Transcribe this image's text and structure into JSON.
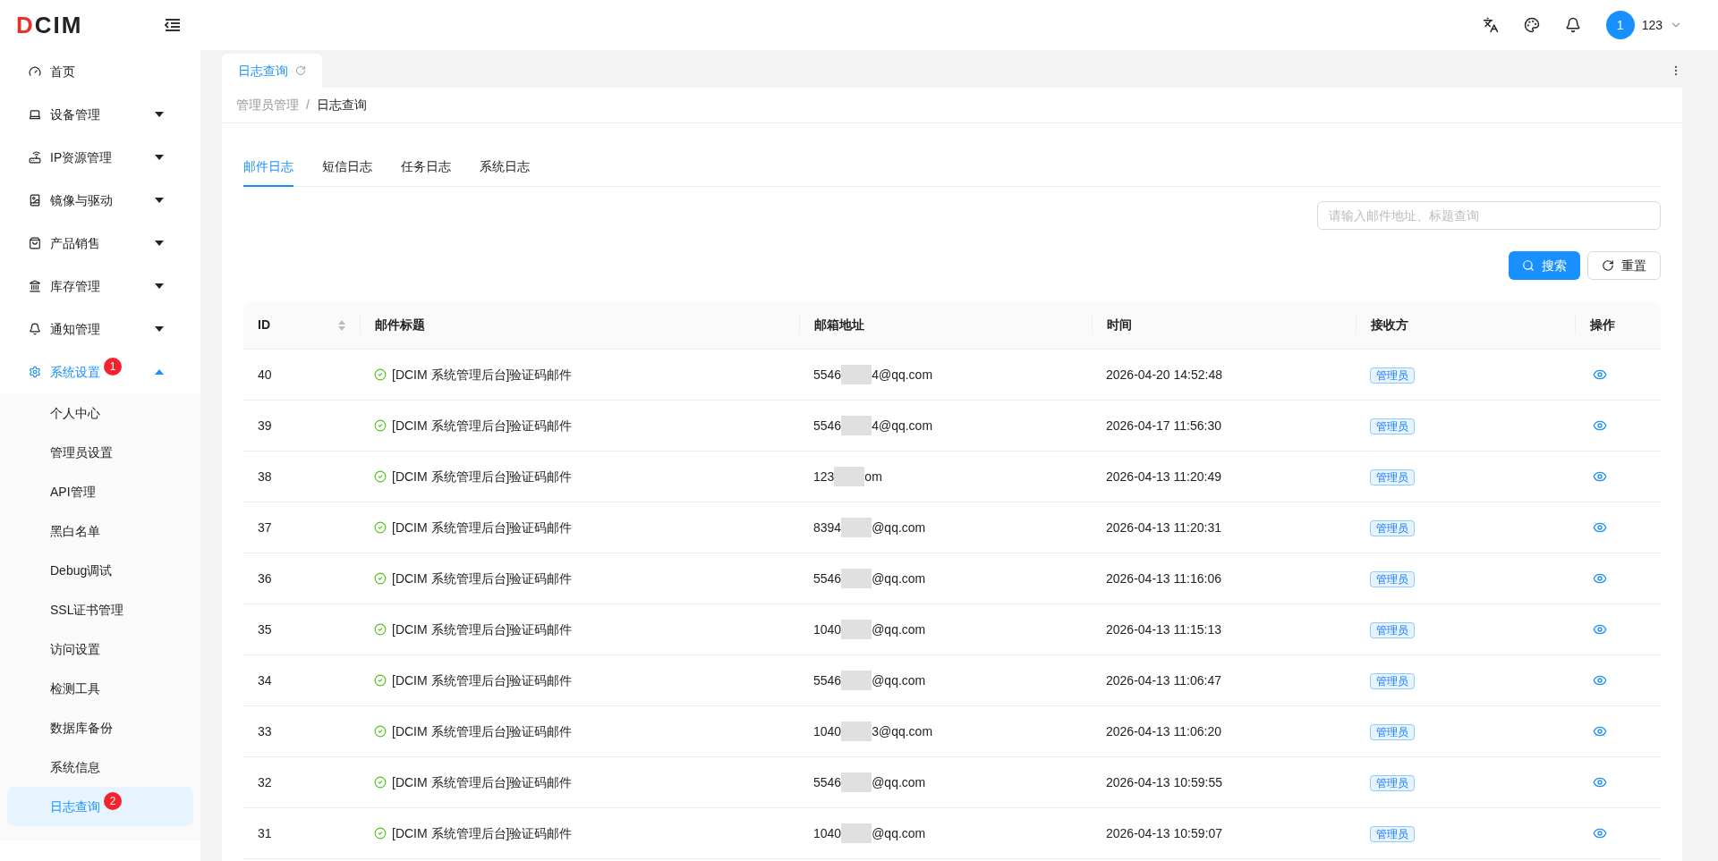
{
  "brand": {
    "text": "DCIM"
  },
  "header": {
    "avatar": "1",
    "user": "123"
  },
  "sidebar": {
    "items": [
      {
        "label": "首页",
        "expandable": false,
        "expanded": false,
        "selected": false
      },
      {
        "label": "设备管理",
        "expandable": true,
        "expanded": false,
        "selected": false
      },
      {
        "label": "IP资源管理",
        "expandable": true,
        "expanded": false,
        "selected": false
      },
      {
        "label": "镜像与驱动",
        "expandable": true,
        "expanded": false,
        "selected": false
      },
      {
        "label": "产品销售",
        "expandable": true,
        "expanded": false,
        "selected": false
      },
      {
        "label": "库存管理",
        "expandable": true,
        "expanded": false,
        "selected": false
      },
      {
        "label": "通知管理",
        "expandable": true,
        "expanded": false,
        "selected": false
      },
      {
        "label": "系统设置",
        "expandable": true,
        "expanded": true,
        "selected": true,
        "badge": "1",
        "children": [
          {
            "label": "个人中心",
            "selected": false
          },
          {
            "label": "管理员设置",
            "selected": false
          },
          {
            "label": "API管理",
            "selected": false
          },
          {
            "label": "黑白名单",
            "selected": false
          },
          {
            "label": "Debug调试",
            "selected": false
          },
          {
            "label": "SSL证书管理",
            "selected": false
          },
          {
            "label": "访问设置",
            "selected": false
          },
          {
            "label": "检测工具",
            "selected": false
          },
          {
            "label": "数据库备份",
            "selected": false
          },
          {
            "label": "系统信息",
            "selected": false
          },
          {
            "label": "日志查询",
            "selected": true,
            "badge": "2"
          }
        ]
      }
    ]
  },
  "page_tabs": [
    {
      "label": "日志查询",
      "selected": true
    }
  ],
  "breadcrumb": [
    "管理员管理",
    "/",
    "日志查询"
  ],
  "tabs": [
    {
      "label": "邮件日志",
      "selected": true
    },
    {
      "label": "短信日志",
      "selected": false
    },
    {
      "label": "任务日志",
      "selected": false
    },
    {
      "label": "系统日志",
      "selected": false
    }
  ],
  "search": {
    "placeholder": "请输入邮件地址、标题查询"
  },
  "buttons": [
    {
      "label": "搜索",
      "kind": "primary"
    },
    {
      "label": "重置",
      "kind": "default"
    }
  ],
  "table": {
    "columns": [
      "ID",
      "邮件标题",
      "邮箱地址",
      "时间",
      "接收方",
      "操作"
    ],
    "rows": [
      {
        "id": "40",
        "title": "[DCIM 系统管理后台]验证码邮件",
        "email_start": "5546",
        "email_end": "4@qq.com",
        "time": "2026-04-20 14:52:48",
        "receiver": "管理员"
      },
      {
        "id": "39",
        "title": "[DCIM 系统管理后台]验证码邮件",
        "email_start": "5546",
        "email_end": "4@qq.com",
        "time": "2026-04-17 11:56:30",
        "receiver": "管理员"
      },
      {
        "id": "38",
        "title": "[DCIM 系统管理后台]验证码邮件",
        "email_start": "123",
        "email_end": "om",
        "time": "2026-04-13 11:20:49",
        "receiver": "管理员"
      },
      {
        "id": "37",
        "title": "[DCIM 系统管理后台]验证码邮件",
        "email_start": "8394",
        "email_end": "@qq.com",
        "time": "2026-04-13 11:20:31",
        "receiver": "管理员"
      },
      {
        "id": "36",
        "title": "[DCIM 系统管理后台]验证码邮件",
        "email_start": "5546",
        "email_end": "@qq.com",
        "time": "2026-04-13 11:16:06",
        "receiver": "管理员"
      },
      {
        "id": "35",
        "title": "[DCIM 系统管理后台]验证码邮件",
        "email_start": "1040",
        "email_end": "@qq.com",
        "time": "2026-04-13 11:15:13",
        "receiver": "管理员"
      },
      {
        "id": "34",
        "title": "[DCIM 系统管理后台]验证码邮件",
        "email_start": "5546",
        "email_end": "@qq.com",
        "time": "2026-04-13 11:06:47",
        "receiver": "管理员"
      },
      {
        "id": "33",
        "title": "[DCIM 系统管理后台]验证码邮件",
        "email_start": "1040",
        "email_end": "3@qq.com",
        "time": "2026-04-13 11:06:20",
        "receiver": "管理员"
      },
      {
        "id": "32",
        "title": "[DCIM 系统管理后台]验证码邮件",
        "email_start": "5546",
        "email_end": "@qq.com",
        "time": "2026-04-13 10:59:55",
        "receiver": "管理员"
      },
      {
        "id": "31",
        "title": "[DCIM 系统管理后台]验证码邮件",
        "email_start": "1040",
        "email_end": "@qq.com",
        "time": "2026-04-13 10:59:07",
        "receiver": "管理员"
      }
    ]
  }
}
